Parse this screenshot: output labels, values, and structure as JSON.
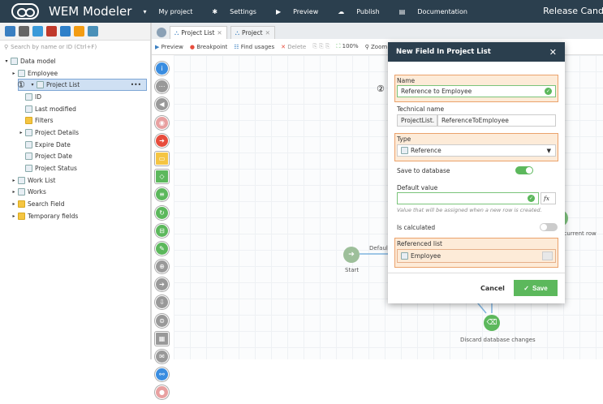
{
  "app": {
    "title": "WEM Modeler",
    "release": "Release Candi"
  },
  "nav": [
    {
      "icon": "caret-down-icon",
      "glyph": "▾",
      "label": "My project"
    },
    {
      "icon": "gear-icon",
      "glyph": "✱",
      "label": "Settings"
    },
    {
      "icon": "play-icon",
      "glyph": "▶",
      "label": "Preview"
    },
    {
      "icon": "cloud-upload-icon",
      "glyph": "☁",
      "label": "Publish"
    },
    {
      "icon": "book-icon",
      "glyph": "▤",
      "label": "Documentation"
    }
  ],
  "search": {
    "placeholder": "Search by name or ID (Ctrl+F)"
  },
  "tree": [
    {
      "label": "Data model",
      "caret": "▾",
      "indent": 0
    },
    {
      "label": "Employee",
      "caret": "▸",
      "indent": 1
    },
    {
      "label": "Project List",
      "caret": "▾",
      "indent": 1,
      "selected": true,
      "more": "•••",
      "badge": "①"
    },
    {
      "label": "ID",
      "caret": "",
      "indent": 2
    },
    {
      "label": "Last modified",
      "caret": "",
      "indent": 2
    },
    {
      "label": "Filters",
      "caret": "",
      "indent": 2,
      "folder": true
    },
    {
      "label": "Project Details",
      "caret": "▸",
      "indent": 2
    },
    {
      "label": "Expire Date",
      "caret": "",
      "indent": 2
    },
    {
      "label": "Project Date",
      "caret": "",
      "indent": 2
    },
    {
      "label": "Project Status",
      "caret": "",
      "indent": 2
    },
    {
      "label": "Work List",
      "caret": "▸",
      "indent": 1
    },
    {
      "label": "Works",
      "caret": "▸",
      "indent": 1
    },
    {
      "label": "Search Field",
      "caret": "▸",
      "indent": 1,
      "folder": true
    },
    {
      "label": "Temporary fields",
      "caret": "▸",
      "indent": 1,
      "folder": true
    }
  ],
  "tabs": [
    {
      "label": "Project List",
      "close": "✕"
    },
    {
      "label": "Project",
      "close": "✕"
    }
  ],
  "canvas_toolbar": [
    "Preview",
    "Breakpoint",
    "Find usages",
    "Delete",
    "100%",
    "Zoom"
  ],
  "canvas": {
    "start": "Start",
    "default_edge": "Default",
    "discard": "Discard database changes",
    "current_row": "e current row"
  },
  "dialog": {
    "title": "New Field In Project List",
    "close": "✕",
    "badge": "②",
    "name_label": "Name",
    "name_value": "Reference to Employee",
    "tech_label": "Technical name",
    "tech_prefix": "ProjectList.",
    "tech_value": "ReferenceToEmployee",
    "type_label": "Type",
    "type_value": "Reference",
    "save_db_label": "Save to database",
    "save_db_on": true,
    "default_label": "Default value",
    "default_value": "",
    "fx": "fx",
    "default_hint": "Value that will be assigned when a new row is created.",
    "calc_label": "Is calculated",
    "calc_on": false,
    "ref_label": "Referenced list",
    "ref_value": "Employee",
    "cancel": "Cancel",
    "save": "Save"
  },
  "colors": {
    "header": "#2b3f4e",
    "accent": "#5cb85c",
    "highlight": "#fdebd8",
    "highlight_border": "#eba26b"
  }
}
